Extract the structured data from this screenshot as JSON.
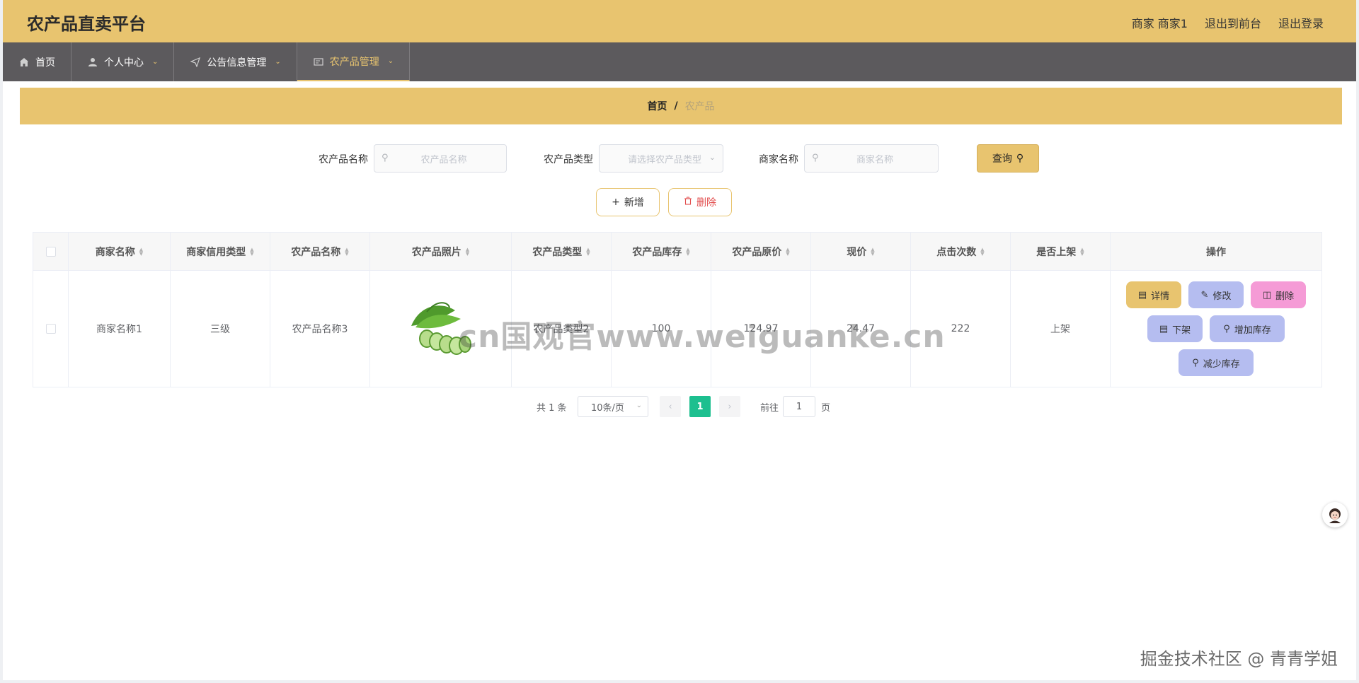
{
  "header": {
    "app_title": "农产品直卖平台",
    "user_label": "商家 商家1",
    "back_to_front": "退出到前台",
    "logout": "退出登录"
  },
  "nav": {
    "items": [
      {
        "label": "首页",
        "icon": "home-icon"
      },
      {
        "label": "个人中心",
        "icon": "user-icon"
      },
      {
        "label": "公告信息管理",
        "icon": "send-icon"
      },
      {
        "label": "农产品管理",
        "icon": "card-icon"
      }
    ]
  },
  "breadcrumb": {
    "home": "首页",
    "separator": "/",
    "current": "农产品"
  },
  "search": {
    "name_label": "农产品名称",
    "name_placeholder": "农产品名称",
    "type_label": "农产品类型",
    "type_placeholder": "请选择农产品类型",
    "merchant_label": "商家名称",
    "merchant_placeholder": "商家名称",
    "query_label": "查询"
  },
  "actions": {
    "add_label": "新增",
    "delete_label": "删除"
  },
  "table": {
    "headers": [
      "商家名称",
      "商家信用类型",
      "农产品名称",
      "农产品照片",
      "农产品类型",
      "农产品库存",
      "农产品原价",
      "现价",
      "点击次数",
      "是否上架",
      "操作"
    ],
    "rows": [
      {
        "merchant": "商家名称1",
        "credit": "三级",
        "product": "农产品名称3",
        "type": "农产品类型2",
        "stock": "100",
        "orig_price": "124.97",
        "price": "24.47",
        "clicks": "222",
        "on_shelf": "上架"
      }
    ],
    "ops": {
      "detail": "详情",
      "edit": "修改",
      "delete": "删除",
      "off_shelf": "下架",
      "add_stock": "增加库存",
      "reduce_stock": "减少库存"
    }
  },
  "pagination": {
    "total": "共 1 条",
    "page_size": "10条/页",
    "current_page": "1",
    "goto_label": "前往",
    "goto_value": "1",
    "page_suffix": "页"
  },
  "watermark": {
    "center": "cn国观官www.weiguanke.cn",
    "corner": "掘金技术社区 @ 青青学姐"
  },
  "colors": {
    "accent": "#e8c46f",
    "nav_bg": "#5c5a5d",
    "page_active": "#1dbf8f",
    "op_blue": "#b5bdf0",
    "op_pink": "#f59bd6"
  }
}
